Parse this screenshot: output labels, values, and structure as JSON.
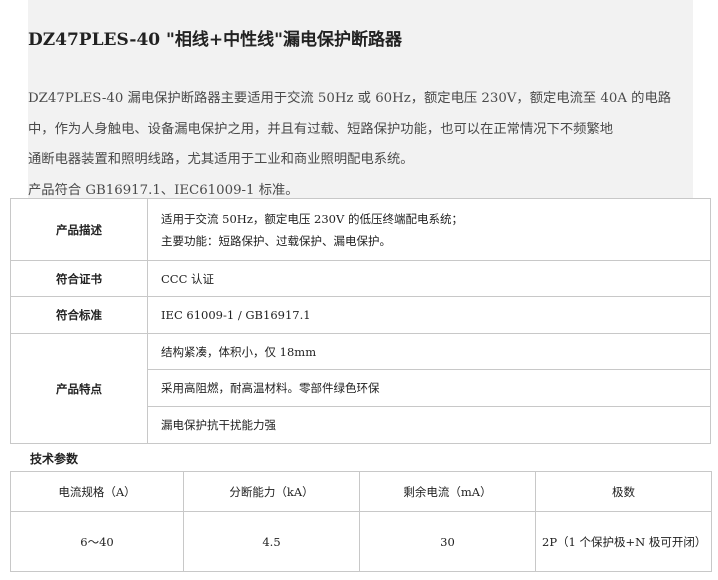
{
  "intro": {
    "title": "DZ47PLES-40 \"相线+中性线\"漏电保护断路器",
    "paragraphs": [
      "DZ47PLES-40 漏电保护断路器主要适用于交流 50Hz 或 60Hz，额定电压 230V，额定电流至 40A 的电路",
      "中，作为人身触电、设备漏电保护之用，并且有过载、短路保护功能，也可以在正常情况下不频繁地",
      "通断电器装置和照明线路，尤其适用于工业和商业照明配电系统。",
      "产品符合 GB16917.1、IEC61009-1 标准。"
    ]
  },
  "spec": {
    "rows": [
      {
        "label": "产品描述",
        "values": [
          "适用于交流 50Hz，额定电压 230V 的低压终端配电系统；",
          "主要功能：短路保护、过载保护、漏电保护。"
        ]
      },
      {
        "label": "符合证书",
        "values": [
          "CCC 认证"
        ]
      },
      {
        "label": "符合标准",
        "values": [
          "IEC 61009-1 / GB16917.1"
        ]
      },
      {
        "label": "产品特点",
        "values": [
          "结构紧凑，体积小，仅 18mm",
          "采用高阻燃，耐高温材料。零部件绿色环保",
          "漏电保护抗干扰能力强"
        ]
      }
    ]
  },
  "tech": {
    "label": "技术参数",
    "headers": [
      "电流规格（A）",
      "分断能力（kA）",
      "剩余电流（mA）",
      "极数"
    ],
    "values": [
      "6～40",
      "4.5",
      "30",
      "2P（1 个保护极+N 极可开闭）"
    ]
  }
}
